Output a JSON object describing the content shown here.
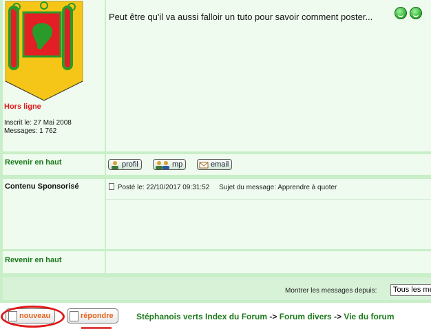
{
  "profile": {
    "status": "Hors ligne",
    "registered": "Inscrit le: 27 Mai 2008",
    "messages": "Messages: 1 762"
  },
  "post": {
    "text": "Peut être qu'il va aussi falloir un tuto pour savoir comment poster...",
    "back_top": "Revenir en haut",
    "buttons": {
      "profile": "profil",
      "pm": "mp",
      "email": "email"
    }
  },
  "sponsored": {
    "author": "Contenu Sponsorisé",
    "posted": "Posté le: 22/10/2017 09:31:52",
    "subject": "Sujet du message: Apprendre à quoter",
    "back_top": "Revenir en haut"
  },
  "footer": {
    "show_label": "Montrer les messages depuis:",
    "show_value": "Tous les messages"
  },
  "actions": {
    "new": "nouveau",
    "reply": "répondre"
  },
  "breadcrumb": {
    "index": "Stéphanois verts Index du Forum",
    "sep1": " -> ",
    "section": "Forum divers",
    "sep2": " -> ",
    "current": "Vie du forum"
  },
  "colors": {
    "accent_green": "#1d7a1d",
    "status_red": "#e01b1b",
    "highlight_red": "#e01818"
  }
}
